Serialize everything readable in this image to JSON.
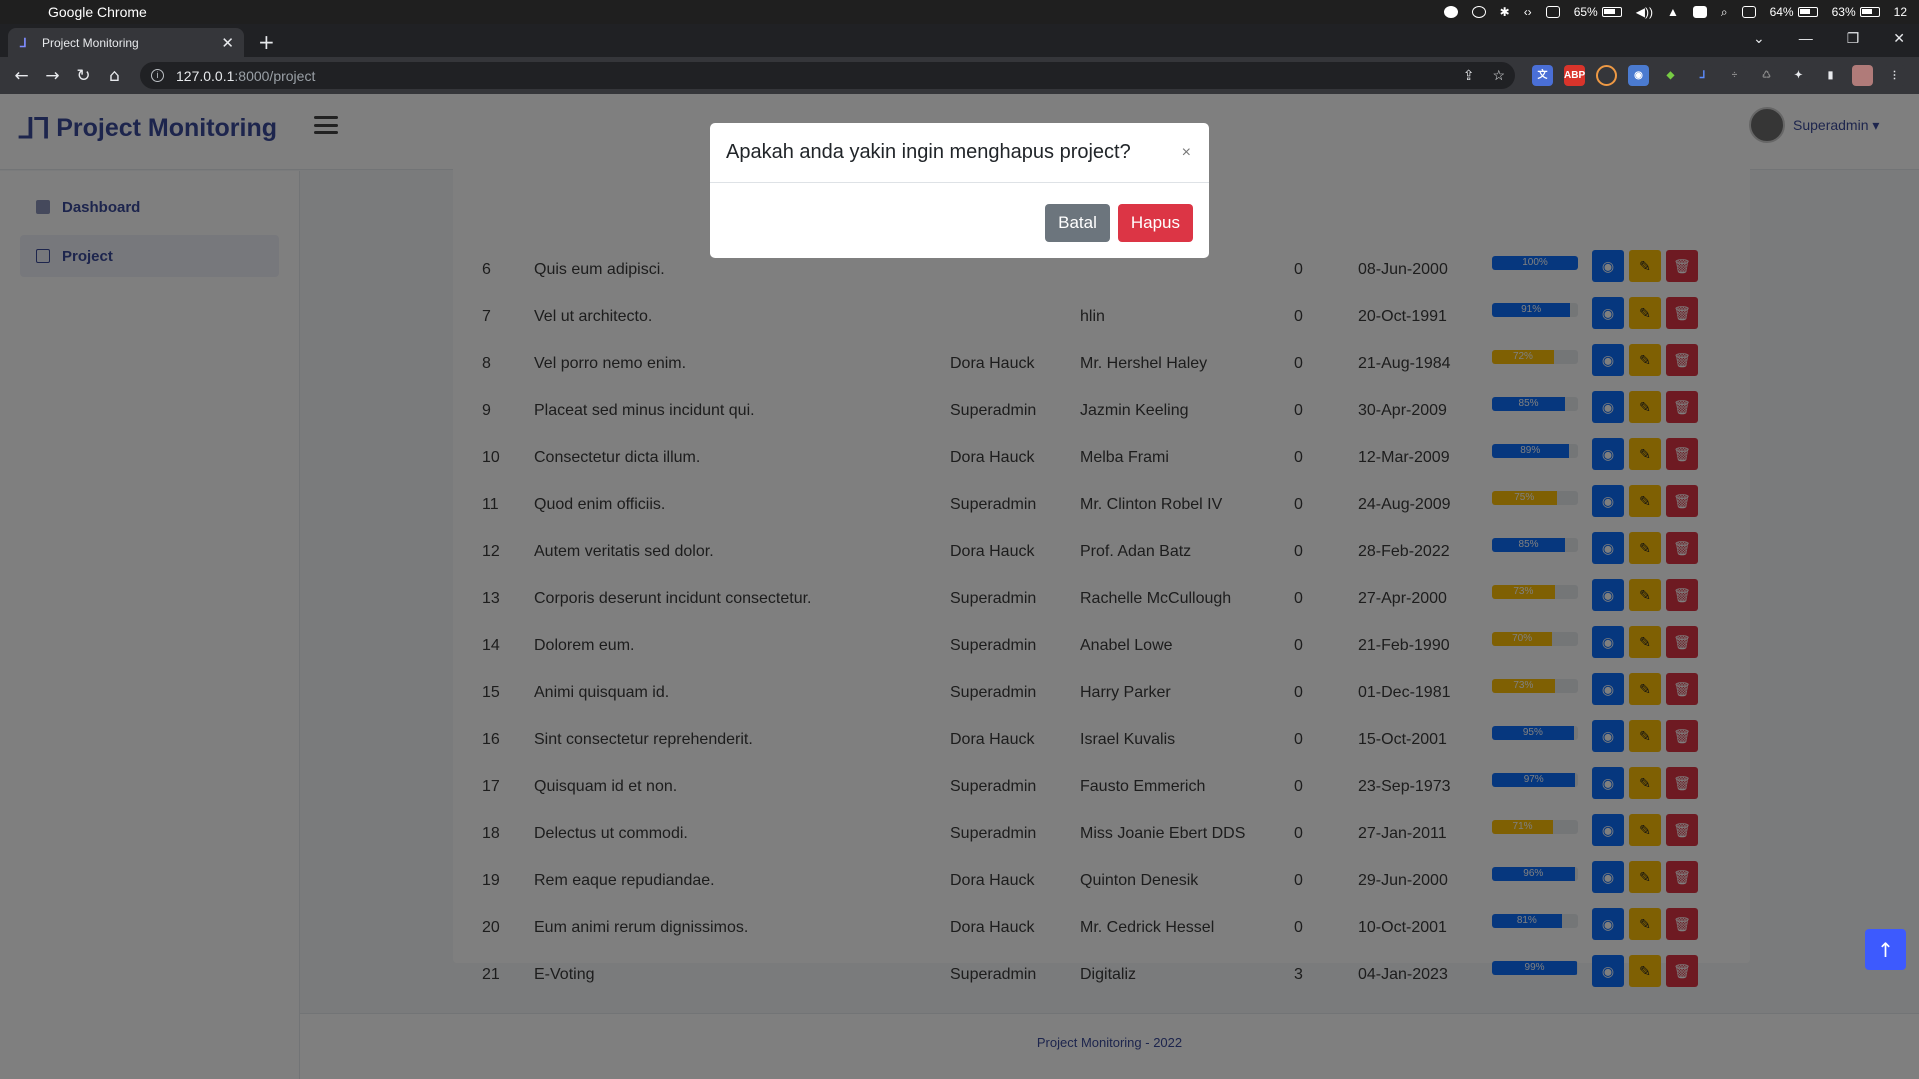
{
  "os": {
    "app_name": "Google Chrome",
    "status": {
      "battery1": "65%",
      "battery2": "64%",
      "battery3": "63%",
      "time": "12"
    }
  },
  "browser": {
    "tab_title": "Project Monitoring",
    "url_host": "127.0.0.1",
    "url_path": ":8000/project"
  },
  "app": {
    "brand": "Project Monitoring",
    "user_name": "Superadmin ▾",
    "sidebar": [
      {
        "label": "Dashboard",
        "icon": "home-icon"
      },
      {
        "label": "Project",
        "icon": "project-icon"
      }
    ],
    "footer": "Project Monitoring - 2022"
  },
  "modal": {
    "title": "Apakah anda yakin ingin menghapus project?",
    "cancel_label": "Batal",
    "delete_label": "Hapus",
    "close_label": "×"
  },
  "colors": {
    "progress_blue": "#0d6efd",
    "progress_yellow": "#ffc107",
    "accent": "#3b4a9a"
  },
  "rows": [
    {
      "no": "6",
      "name": "Quis eum adipisci.",
      "creator": "",
      "client": "",
      "count": "0",
      "date": "08-Jun-2000",
      "progress": 100,
      "label": "100%",
      "color": "blue"
    },
    {
      "no": "7",
      "name": "Vel ut architecto.",
      "creator": "",
      "client": "hlin",
      "count": "0",
      "date": "20-Oct-1991",
      "progress": 91,
      "label": "91%",
      "color": "blue"
    },
    {
      "no": "8",
      "name": "Vel porro nemo enim.",
      "creator": "Dora Hauck",
      "client": "Mr. Hershel Haley",
      "count": "0",
      "date": "21-Aug-1984",
      "progress": 72,
      "label": "72%",
      "color": "yellow"
    },
    {
      "no": "9",
      "name": "Placeat sed minus incidunt qui.",
      "creator": "Superadmin",
      "client": "Jazmin Keeling",
      "count": "0",
      "date": "30-Apr-2009",
      "progress": 85,
      "label": "85%",
      "color": "blue"
    },
    {
      "no": "10",
      "name": "Consectetur dicta illum.",
      "creator": "Dora Hauck",
      "client": "Melba Frami",
      "count": "0",
      "date": "12-Mar-2009",
      "progress": 89,
      "label": "89%",
      "color": "blue"
    },
    {
      "no": "11",
      "name": "Quod enim officiis.",
      "creator": "Superadmin",
      "client": "Mr. Clinton Robel IV",
      "count": "0",
      "date": "24-Aug-2009",
      "progress": 75,
      "label": "75%",
      "color": "yellow"
    },
    {
      "no": "12",
      "name": "Autem veritatis sed dolor.",
      "creator": "Dora Hauck",
      "client": "Prof. Adan Batz",
      "count": "0",
      "date": "28-Feb-2022",
      "progress": 85,
      "label": "85%",
      "color": "blue"
    },
    {
      "no": "13",
      "name": "Corporis deserunt incidunt consectetur.",
      "creator": "Superadmin",
      "client": "Rachelle McCullough",
      "count": "0",
      "date": "27-Apr-2000",
      "progress": 73,
      "label": "73%",
      "color": "yellow"
    },
    {
      "no": "14",
      "name": "Dolorem eum.",
      "creator": "Superadmin",
      "client": "Anabel Lowe",
      "count": "0",
      "date": "21-Feb-1990",
      "progress": 70,
      "label": "70%",
      "color": "yellow"
    },
    {
      "no": "15",
      "name": "Animi quisquam id.",
      "creator": "Superadmin",
      "client": "Harry Parker",
      "count": "0",
      "date": "01-Dec-1981",
      "progress": 73,
      "label": "73%",
      "color": "yellow"
    },
    {
      "no": "16",
      "name": "Sint consectetur reprehenderit.",
      "creator": "Dora Hauck",
      "client": "Israel Kuvalis",
      "count": "0",
      "date": "15-Oct-2001",
      "progress": 95,
      "label": "95%",
      "color": "blue"
    },
    {
      "no": "17",
      "name": "Quisquam id et non.",
      "creator": "Superadmin",
      "client": "Fausto Emmerich",
      "count": "0",
      "date": "23-Sep-1973",
      "progress": 97,
      "label": "97%",
      "color": "blue"
    },
    {
      "no": "18",
      "name": "Delectus ut commodi.",
      "creator": "Superadmin",
      "client": "Miss Joanie Ebert DDS",
      "count": "0",
      "date": "27-Jan-2011",
      "progress": 71,
      "label": "71%",
      "color": "yellow"
    },
    {
      "no": "19",
      "name": "Rem eaque repudiandae.",
      "creator": "Dora Hauck",
      "client": "Quinton Denesik",
      "count": "0",
      "date": "29-Jun-2000",
      "progress": 96,
      "label": "96%",
      "color": "blue"
    },
    {
      "no": "20",
      "name": "Eum animi rerum dignissimos.",
      "creator": "Dora Hauck",
      "client": "Mr. Cedrick Hessel",
      "count": "0",
      "date": "10-Oct-2001",
      "progress": 81,
      "label": "81%",
      "color": "blue"
    },
    {
      "no": "21",
      "name": "E-Voting",
      "creator": "Superadmin",
      "client": "Digitaliz",
      "count": "3",
      "date": "04-Jan-2023",
      "progress": 99,
      "label": "99%",
      "color": "blue"
    }
  ]
}
